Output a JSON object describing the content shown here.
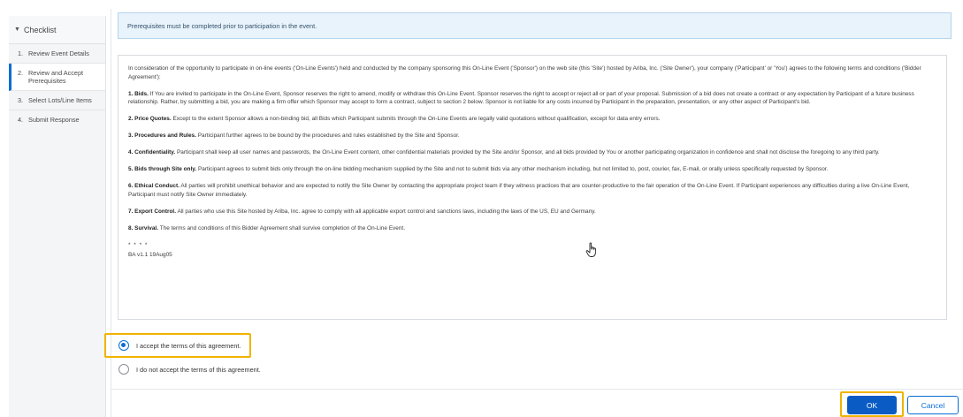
{
  "sidebar": {
    "title": "Checklist",
    "steps": [
      {
        "num": "1.",
        "label": "Review Event Details"
      },
      {
        "num": "2.",
        "label": "Review and Accept Prerequisites"
      },
      {
        "num": "3.",
        "label": "Select Lots/Line Items"
      },
      {
        "num": "4.",
        "label": "Submit Response"
      }
    ]
  },
  "banner": {
    "text": "Prerequisites must be completed prior to participation in the event."
  },
  "agreement": {
    "intro": "In consideration of the opportunity to participate in on-line events ('On-Line Events') held and conducted by the company sponsoring this On-Line Event ('Sponsor') on the web site (this 'Site') hosted by Ariba, Inc. ('Site Owner'), your company ('Participant' or 'You') agrees to the following terms and conditions ('Bidder Agreement'):",
    "clauses": [
      {
        "title": "1. Bids.",
        "text": "If You are invited to participate in the On-Line Event, Sponsor reserves the right to amend, modify or withdraw this On-Line Event. Sponsor reserves the right to accept or reject all or part of your proposal. Submission of a bid does not create a contract or any expectation by Participant of a future business relationship. Rather, by submitting a bid, you are making a firm offer which Sponsor may accept to form a contract, subject to section 2 below. Sponsor is not liable for any costs incurred by Participant in the preparation, presentation, or any other aspect of Participant's bid."
      },
      {
        "title": "2. Price Quotes.",
        "text": "Except to the extent Sponsor allows a non-binding bid, all Bids which Participant submits through the On-Line Events are legally valid quotations without qualification, except for data entry errors."
      },
      {
        "title": "3. Procedures and Rules.",
        "text": "Participant further agrees to be bound by the procedures and rules established by the Site and Sponsor."
      },
      {
        "title": "4. Confidentiality.",
        "text": "Participant shall keep all user names and passwords, the On-Line Event content, other confidential materials provided by the Site and/or Sponsor, and all bids provided by You or another participating organization in confidence and shall not disclose the foregoing to any third party."
      },
      {
        "title": "5. Bids through Site only.",
        "text": "Participant agrees to submit bids only through the on-line bidding mechanism supplied by the Site and not to submit bids via any other mechanism including, but not limited to, post, courier, fax, E-mail, or orally unless specifically requested by Sponsor."
      },
      {
        "title": "6. Ethical Conduct.",
        "text": "All parties will prohibit unethical behavior and are expected to notify the Site Owner by contacting the appropriate project team if they witness practices that are counter-productive to the fair operation of the On-Line Event. If Participant experiences any difficulties during a live On-Line Event, Participant must notify Site Owner immediately."
      },
      {
        "title": "7. Export Control.",
        "text": "All parties who use this Site hosted by Ariba, Inc. agree to comply with all applicable export control and sanctions laws, including the laws of the US, EU and Germany."
      },
      {
        "title": "8. Survival.",
        "text": "The terms and conditions of this Bidder Agreement shall survive completion of the On-Line Event."
      }
    ],
    "stars": "* * * *",
    "version": "BA v1.1 19Aug05"
  },
  "options": {
    "accept": "I accept the terms of this agreement.",
    "decline": "I do not accept the terms of this agreement.",
    "selected": "accept"
  },
  "buttons": {
    "ok": "OK",
    "cancel": "Cancel"
  },
  "colors": {
    "accent": "#0a6ed1",
    "highlight": "#f0b400",
    "banner_bg": "#e8f3fb"
  },
  "icons": {
    "checklist_caret": "caret-down-icon",
    "cursor": "hand-pointer-icon"
  }
}
